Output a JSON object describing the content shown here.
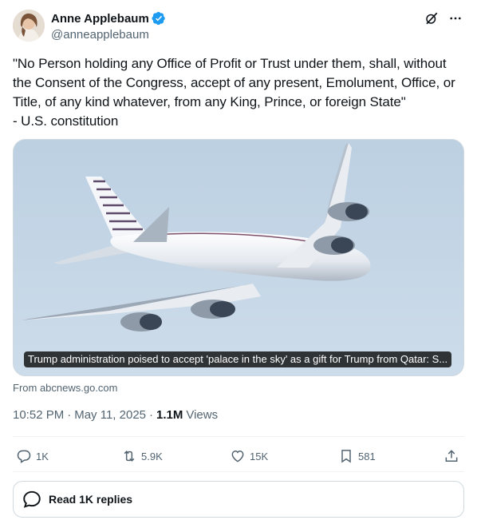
{
  "author": {
    "display_name": "Anne Applebaum",
    "handle": "@anneapplebaum",
    "verified": true
  },
  "tweet": {
    "text": "\"No Person holding any Office of Profit or Trust under them, shall, without the Consent of the Congress, accept of any present, Emolument, Office, or Title, of any kind whatever, from any King, Prince, or foreign State\"\n- U.S. constitution"
  },
  "card": {
    "caption": "Trump administration poised to accept 'palace in the sky' as a gift for Trump from Qatar: S...",
    "source": "From abcnews.go.com"
  },
  "meta": {
    "time": "10:52 PM",
    "separator": "·",
    "date": "May 11, 2025",
    "views_count": "1.1M",
    "views_label": "Views"
  },
  "actions": {
    "replies": "1K",
    "reposts": "5.9K",
    "likes": "15K",
    "bookmarks": "581"
  },
  "read_replies_label": "Read 1K replies",
  "icons": [
    "verified-badge-icon",
    "grok-icon",
    "more-icon",
    "reply-icon",
    "repost-icon",
    "like-icon",
    "bookmark-icon",
    "share-icon",
    "chat-bubble-icon"
  ],
  "colors": {
    "accent": "#1d9bf0",
    "text_primary": "#0f1419",
    "text_secondary": "#536471",
    "border": "#cfd9de"
  }
}
